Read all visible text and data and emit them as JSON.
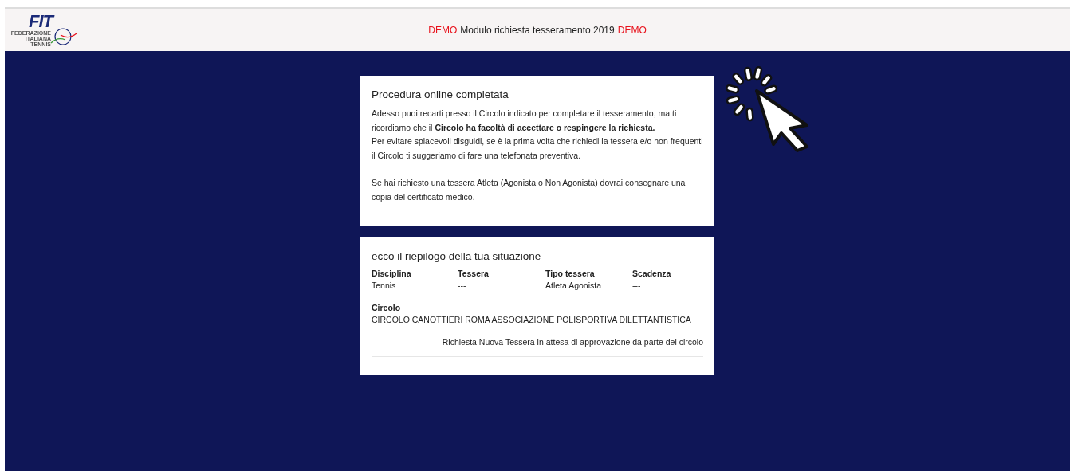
{
  "header": {
    "logo": {
      "mark": "FIT",
      "lines": [
        "FEDERAZIONE",
        "ITALIANA",
        "TENNIS"
      ]
    },
    "title_parts": [
      {
        "text": "DEMO",
        "kind": "highlight"
      },
      {
        "text": "Modulo richiesta tesseramento 2019",
        "kind": "plain"
      },
      {
        "text": "DEMO",
        "kind": "highlight"
      }
    ]
  },
  "completion_card": {
    "title": "Procedura online completata",
    "groups": [
      [
        "Adesso puoi recarti presso il Circolo indicato per completare il tesseramento, ma ti ricordiamo che il **Circolo ha facoltà di accettare o respingere la richiesta.**",
        "Per evitare spiacevoli disguidi, se è la prima volta che richiedi la tessera e/o non frequenti il Circolo ti suggeriamo di fare una telefonata preventiva."
      ],
      [
        "Se hai richiesto una tessera Atleta (Agonista o Non Agonista) dovrai consegnare una copia del certificato medico."
      ]
    ]
  },
  "summary_card": {
    "title": "ecco il riepilogo della tua situazione",
    "fields": [
      {
        "label": "Disciplina",
        "value": "Tennis"
      },
      {
        "label": "Tessera",
        "value": "---"
      },
      {
        "label": "Tipo tessera",
        "value": "Atleta Agonista"
      },
      {
        "label": "Scadenza",
        "value": "---"
      }
    ],
    "circolo": {
      "label": "Circolo",
      "value": "CIRCOLO CANOTTIERI ROMA ASSOCIAZIONE POLISPORTIVA DILETTANTISTICA"
    },
    "status": "Richiesta Nuova Tessera in attesa di approvazione da parte del circolo"
  }
}
